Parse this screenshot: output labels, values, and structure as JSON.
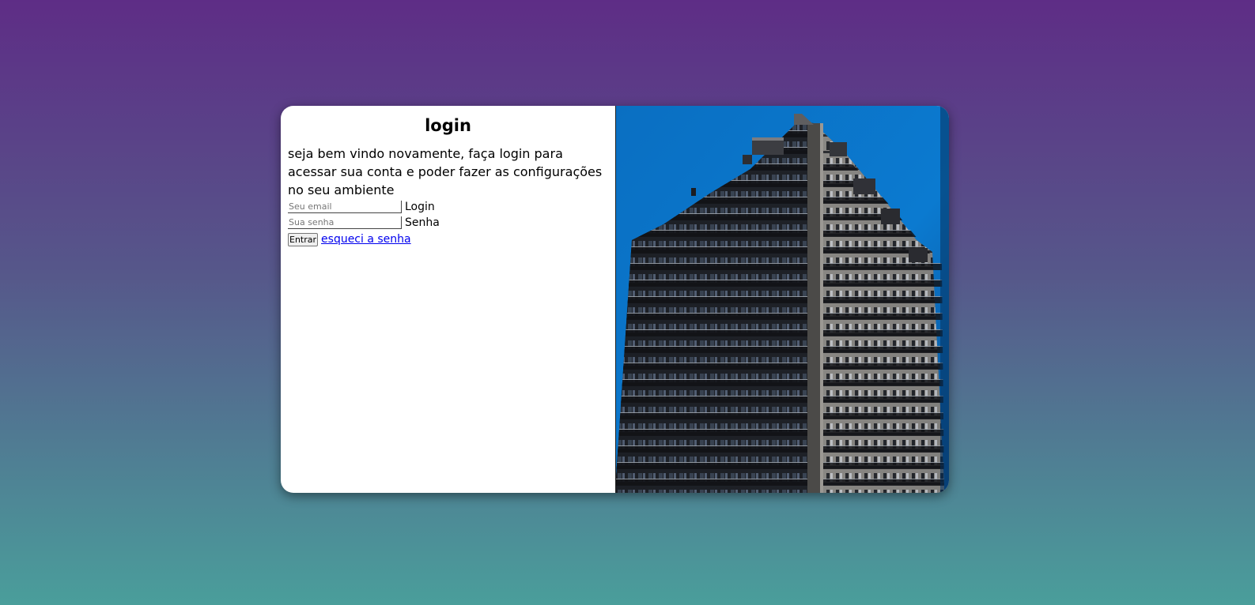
{
  "login": {
    "title": "login",
    "intro": "seja bem vindo novamente, faça login para acessar sua conta e poder fazer as configurações no seu ambiente",
    "email_placeholder": "Seu email",
    "email_label": "Login",
    "password_placeholder": "Sua senha",
    "password_label": "Senha",
    "submit_label": "Entrar",
    "forgot_link": "esqueci a senha"
  },
  "hero_image": {
    "subject": "high-rise residential building with balconies against blue sky"
  },
  "colors": {
    "background_top": "#5e2d86",
    "background_bottom": "#4a9e9b",
    "card": "#ffffff",
    "link": "#0000ee",
    "sky": "#0a72c8"
  }
}
